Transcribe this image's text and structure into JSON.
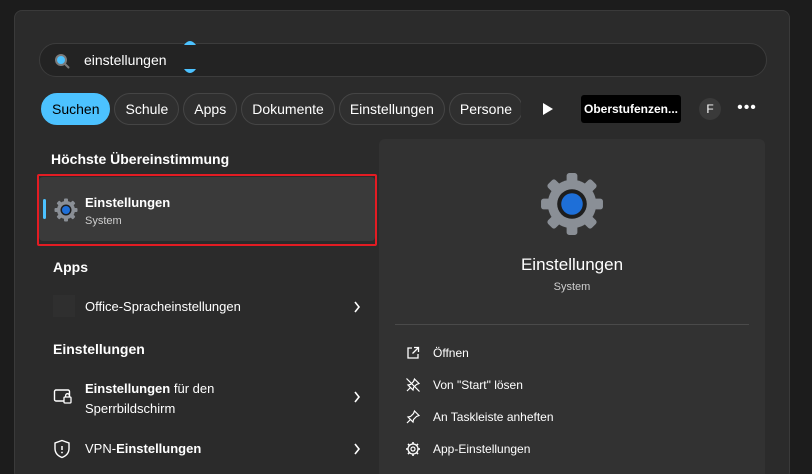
{
  "search": {
    "query": "einstellungen",
    "icon": "search-icon"
  },
  "filters": {
    "chips": [
      {
        "label": "Suchen",
        "active": true
      },
      {
        "label": "Schule",
        "active": false
      },
      {
        "label": "Apps",
        "active": false
      },
      {
        "label": "Dokumente",
        "active": false
      },
      {
        "label": "Einstellungen",
        "active": false
      },
      {
        "label": "Persone",
        "active": false
      }
    ],
    "org_label": "Oberstufenzen...",
    "avatar_letter": "F",
    "more_label": "•••"
  },
  "results": {
    "best_match_heading": "Höchste Übereinstimmung",
    "best_match": {
      "title": "Einstellungen",
      "subtitle": "System",
      "icon": "settings-gear-icon"
    },
    "apps_heading": "Apps",
    "apps": [
      {
        "title": "Office-Spracheinstellungen",
        "icon": "office-app-icon"
      }
    ],
    "settings_heading": "Einstellungen",
    "settings": [
      {
        "title_bold": "Einstellungen",
        "title_rest": " für den",
        "title_line2": "Sperrbildschirm",
        "icon": "lockscreen-icon"
      },
      {
        "title_prefix": "VPN-",
        "title_bold": "Einstellungen",
        "icon": "shield-icon"
      }
    ]
  },
  "detail": {
    "title": "Einstellungen",
    "subtitle": "System",
    "actions": [
      {
        "label": "Öffnen",
        "icon": "open-external-icon"
      },
      {
        "label": "Von \"Start\" lösen",
        "icon": "unpin-icon"
      },
      {
        "label": "An Taskleiste anheften",
        "icon": "pin-icon"
      },
      {
        "label": "App-Einstellungen",
        "icon": "gear-icon"
      }
    ]
  },
  "colors": {
    "accent": "#4cc2ff",
    "highlight": "#e31c23",
    "panel": "#2b2b2b"
  }
}
